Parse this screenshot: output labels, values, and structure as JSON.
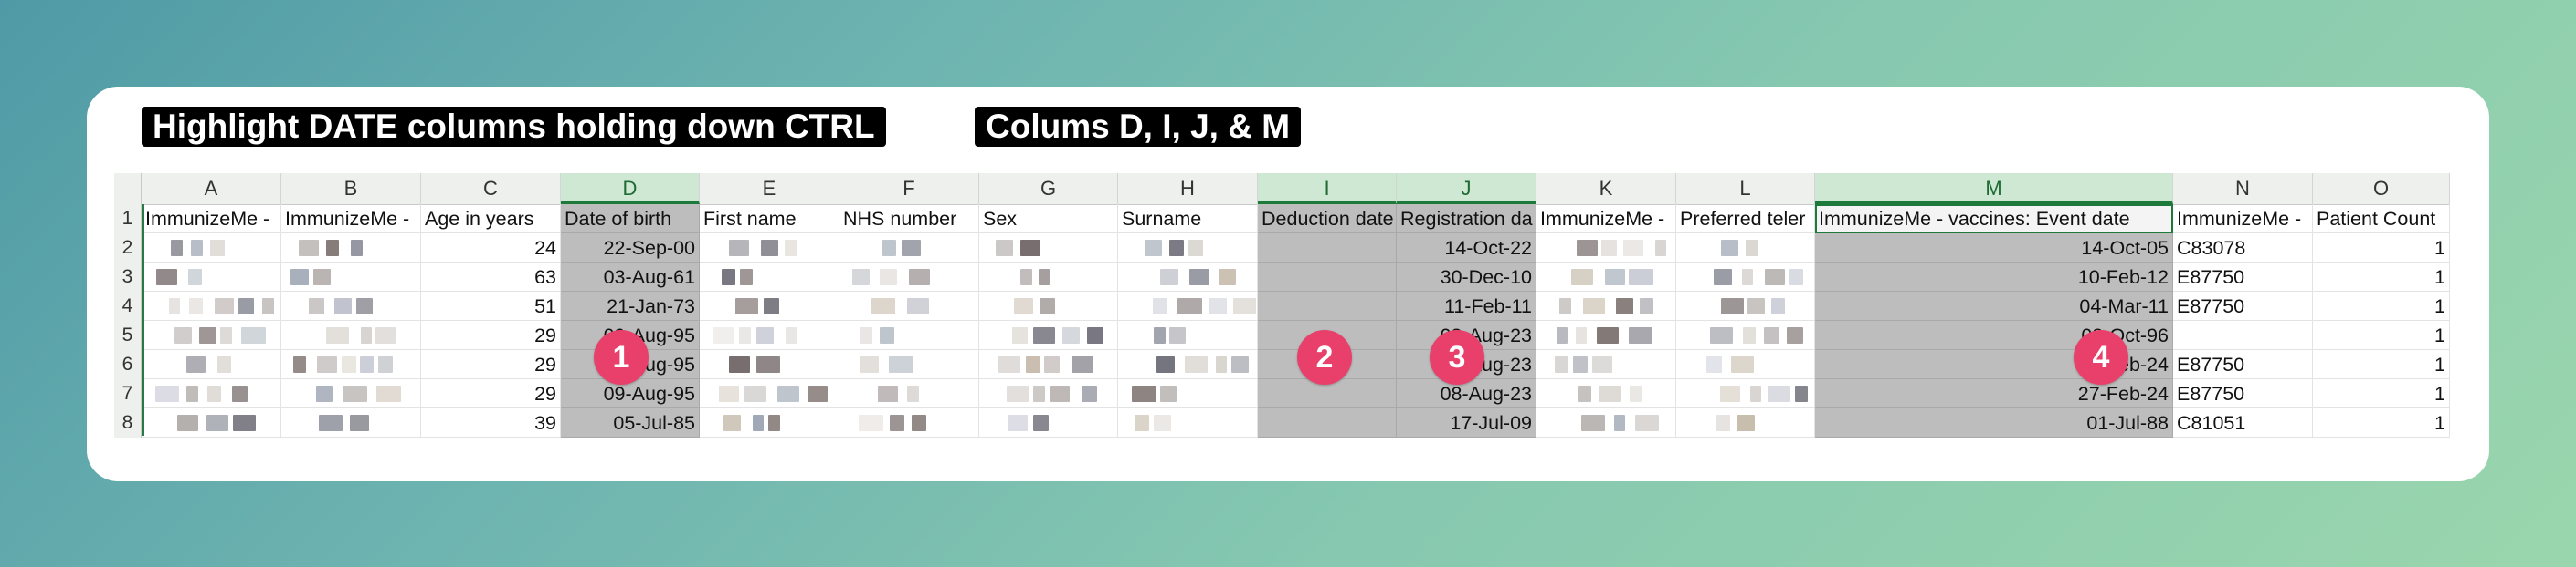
{
  "banners": {
    "instruction": "Highlight DATE columns holding down CTRL",
    "columns_note": "Colums D, I, J, & M"
  },
  "spreadsheet": {
    "column_letters": [
      "A",
      "B",
      "C",
      "D",
      "E",
      "F",
      "G",
      "H",
      "I",
      "J",
      "K",
      "L",
      "M",
      "N",
      "O"
    ],
    "selected_columns": [
      "D",
      "I",
      "J",
      "M"
    ],
    "row_numbers": [
      "1",
      "2",
      "3",
      "4",
      "5",
      "6",
      "7",
      "8"
    ],
    "headers": {
      "A": "ImmunizeMe -",
      "B": "ImmunizeMe -",
      "C": "Age in years",
      "D": "Date of birth",
      "E": "First name",
      "F": "NHS number",
      "G": "Sex",
      "H": "Surname",
      "I": "Deduction date",
      "J": "Registration da",
      "K": "ImmunizeMe -",
      "L": "Preferred teler",
      "M": "ImmunizeMe - vaccines: Event date",
      "N": "ImmunizeMe -",
      "O": "Patient Count"
    },
    "rows": [
      {
        "C": "24",
        "D": "22-Sep-00",
        "J": "14-Oct-22",
        "M": "14-Oct-05",
        "N": "C83078",
        "O": "1"
      },
      {
        "C": "63",
        "D": "03-Aug-61",
        "J": "30-Dec-10",
        "M": "10-Feb-12",
        "N": "E87750",
        "O": "1"
      },
      {
        "C": "51",
        "D": "21-Jan-73",
        "J": "11-Feb-11",
        "M": "04-Mar-11",
        "N": "E87750",
        "O": "1"
      },
      {
        "C": "29",
        "D": "09-Aug-95",
        "J": "08-Aug-23",
        "M": "08-Oct-96",
        "N": "",
        "O": "1"
      },
      {
        "C": "29",
        "D": "09-Aug-95",
        "J": "08-Aug-23",
        "M": "27-Feb-24",
        "N": "E87750",
        "O": "1"
      },
      {
        "C": "29",
        "D": "09-Aug-95",
        "J": "08-Aug-23",
        "M": "27-Feb-24",
        "N": "E87750",
        "O": "1"
      },
      {
        "C": "39",
        "D": "05-Jul-85",
        "J": "17-Jul-09",
        "M": "01-Jul-88",
        "N": "C81051",
        "O": "1"
      }
    ]
  },
  "markers": [
    {
      "label": "1",
      "column": "D"
    },
    {
      "label": "2",
      "column": "I"
    },
    {
      "label": "3",
      "column": "J"
    },
    {
      "label": "4",
      "column": "M"
    }
  ],
  "colors": {
    "marker": "#e8406a",
    "selected_column_fill": "#bdbdbd",
    "selected_header": "#cfe8d3"
  },
  "icons": {
    "redacted_cells": "pixelated-blur"
  }
}
